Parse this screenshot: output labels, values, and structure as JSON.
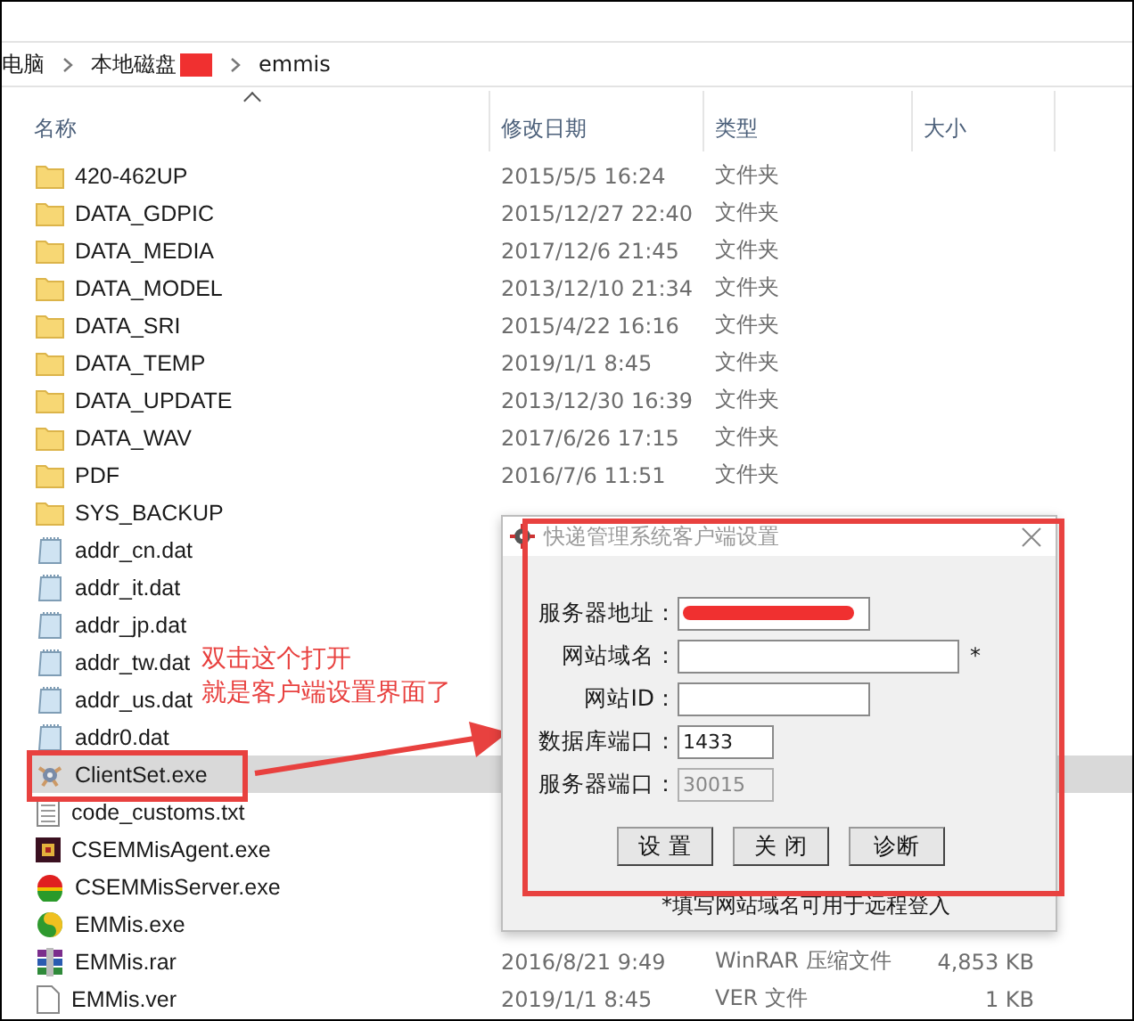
{
  "breadcrumb": [
    {
      "label": "电脑",
      "redacted": false
    },
    {
      "label": "本地磁盘",
      "redacted": true
    },
    {
      "label": "emmis",
      "redacted": false
    }
  ],
  "columns": [
    {
      "label": "名称",
      "sorted": true
    },
    {
      "label": "修改日期",
      "sorted": false
    },
    {
      "label": "类型",
      "sorted": false
    },
    {
      "label": "大小",
      "sorted": false
    }
  ],
  "files": [
    {
      "name": "420-462UP",
      "kind": "folder",
      "modified": "2015/5/5 16:24",
      "type": "文件夹",
      "selected": false
    },
    {
      "name": "DATA_GDPIC",
      "kind": "folder",
      "modified": "2015/12/27 22:40",
      "type": "文件夹",
      "selected": false
    },
    {
      "name": "DATA_MEDIA",
      "kind": "folder",
      "modified": "2017/12/6 21:45",
      "type": "文件夹",
      "selected": false
    },
    {
      "name": "DATA_MODEL",
      "kind": "folder",
      "modified": "2013/12/10 21:34",
      "type": "文件夹",
      "selected": false
    },
    {
      "name": "DATA_SRI",
      "kind": "folder",
      "modified": "2015/4/22 16:16",
      "type": "文件夹",
      "selected": false
    },
    {
      "name": "DATA_TEMP",
      "kind": "folder",
      "modified": "2019/1/1 8:45",
      "type": "文件夹",
      "selected": false
    },
    {
      "name": "DATA_UPDATE",
      "kind": "folder",
      "modified": "2013/12/30 16:39",
      "type": "文件夹",
      "selected": false
    },
    {
      "name": "DATA_WAV",
      "kind": "folder",
      "modified": "2017/6/26 17:15",
      "type": "文件夹",
      "selected": false
    },
    {
      "name": "PDF",
      "kind": "folder",
      "modified": "2016/7/6 11:51",
      "type": "文件夹",
      "selected": false
    },
    {
      "name": "SYS_BACKUP",
      "kind": "folder",
      "selected": false
    },
    {
      "name": "addr_cn.dat",
      "kind": "data",
      "selected": false
    },
    {
      "name": "addr_it.dat",
      "kind": "data",
      "selected": false
    },
    {
      "name": "addr_jp.dat",
      "kind": "data",
      "selected": false
    },
    {
      "name": "addr_tw.dat",
      "kind": "data",
      "selected": false
    },
    {
      "name": "addr_us.dat",
      "kind": "data",
      "selected": false
    },
    {
      "name": "addr0.dat",
      "kind": "data",
      "selected": false
    },
    {
      "name": "ClientSet.exe",
      "kind": "setup",
      "selected": true
    },
    {
      "name": "code_customs.txt",
      "kind": "text",
      "selected": false
    },
    {
      "name": "CSEMMisAgent.exe",
      "kind": "agent",
      "selected": false
    },
    {
      "name": "CSEMMisServer.exe",
      "kind": "server",
      "selected": false
    },
    {
      "name": "EMMis.exe",
      "kind": "app",
      "selected": false
    },
    {
      "name": "EMMis.rar",
      "kind": "archive",
      "modified": "2016/8/21 9:49",
      "type": "WinRAR 压缩文件",
      "size": "4,853 KB",
      "selected": false
    },
    {
      "name": "EMMis.ver",
      "kind": "file",
      "modified": "2019/1/1 8:45",
      "type": "VER 文件",
      "size": "1 KB",
      "selected": false
    }
  ],
  "annotation": {
    "lines": [
      "双击这个打开",
      "就是客户端设置界面了"
    ]
  },
  "dialog": {
    "title": "快递管理系统客户端设置",
    "fields": [
      {
        "label": "服务器地址：",
        "redacted": true,
        "disabled": false
      },
      {
        "label": "网站域名：",
        "suffix": "*",
        "redacted": false,
        "disabled": false
      },
      {
        "label": "网站ID：",
        "redacted": false,
        "disabled": false
      },
      {
        "label": "数据库端口：",
        "value": "1433",
        "redacted": false,
        "disabled": false
      },
      {
        "label": "服务器端口：",
        "value": "30015",
        "redacted": false,
        "disabled": true
      }
    ],
    "buttons": [
      "设 置",
      "关 闭",
      "诊断"
    ],
    "note": "*填写网站域名可用于远程登入"
  }
}
